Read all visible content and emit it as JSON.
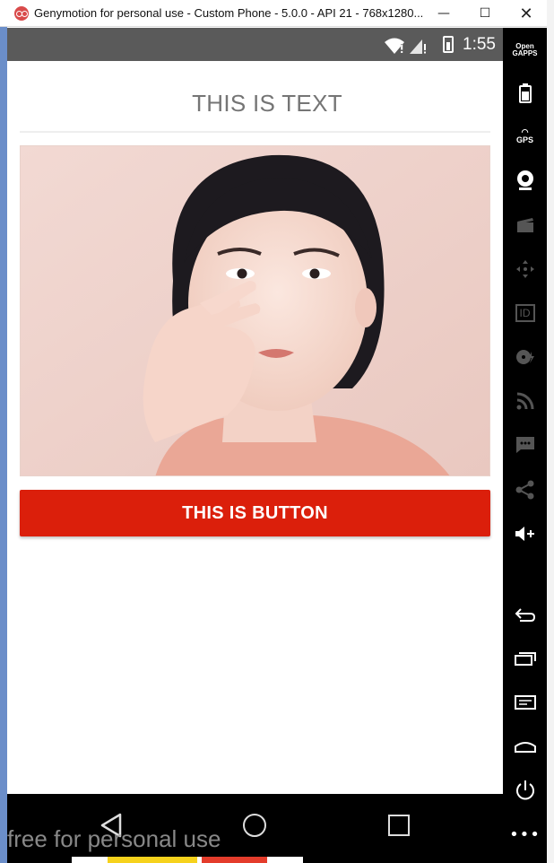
{
  "window": {
    "title": "Genymotion for personal use - Custom Phone - 5.0.0 - API 21 - 768x1280...",
    "minimize_glyph": "—",
    "maximize_glyph": "☐",
    "close_glyph": "✕"
  },
  "status_bar": {
    "time": "1:55",
    "wifi_icon": "wifi-icon",
    "signal_icon": "signal-icon",
    "battery_icon": "battery-icon"
  },
  "app": {
    "text_view": "THIS IS TEXT",
    "button_label": "THIS IS BUTTON",
    "button_color": "#db1f0b",
    "image": "portrait-photo"
  },
  "side_panel": {
    "gapps_label_top": "Open",
    "gapps_label_bottom": "GAPPS",
    "gps_label": "GPS",
    "id_label": "ID",
    "more_glyph": "•••"
  },
  "watermark": "free for personal use"
}
